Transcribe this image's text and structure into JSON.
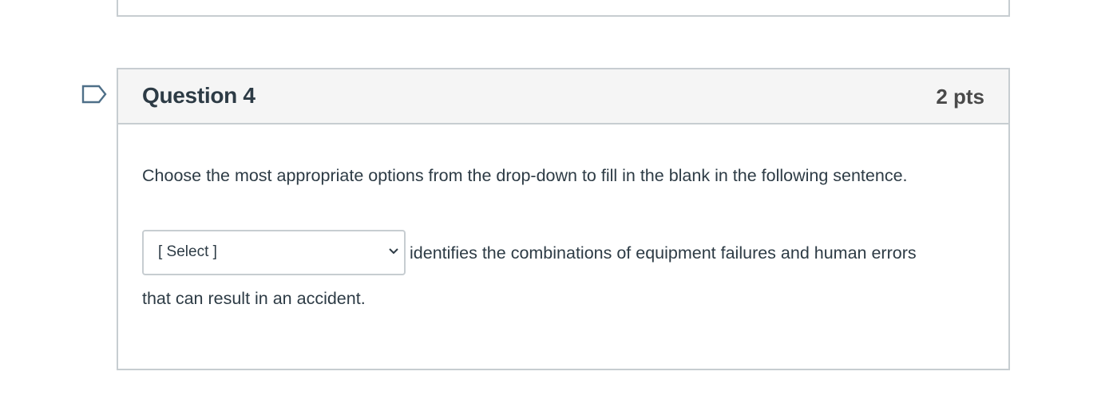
{
  "question": {
    "title": "Question 4",
    "points": "2 pts",
    "prompt": "Choose the most appropriate options from the drop-down to fill in the blank in the following sentence.",
    "select": {
      "selected": "[ Select ]"
    },
    "sentence_after_blank": "identifies the combinations of equipment failures and human errors",
    "sentence_continued": "that can result in an accident.",
    "flag_icon": "bookmark-flag-icon"
  },
  "colors": {
    "border": "#c7cdd1",
    "header_bg": "#f5f5f5",
    "text": "#2d3b45",
    "flag": "#4e6f88"
  }
}
